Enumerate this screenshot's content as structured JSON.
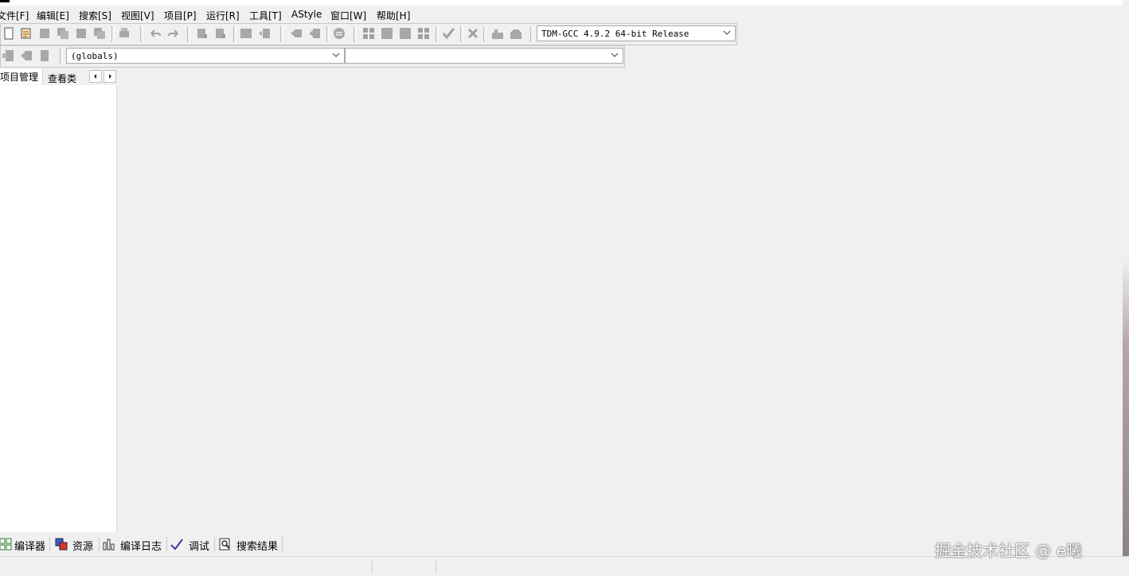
{
  "menubar": {
    "items": [
      "文件[F]",
      "编辑[E]",
      "搜索[S]",
      "视图[V]",
      "项目[P]",
      "运行[R]",
      "工具[T]",
      "AStyle",
      "窗口[W]",
      "帮助[H]"
    ]
  },
  "toolbar": {
    "compiler_select": "TDM-GCC 4.9.2 64-bit Release",
    "scope_select": "(globals)",
    "member_select": ""
  },
  "left_tabs": {
    "project": "项目管理",
    "classes": "查看类"
  },
  "bottom_tabs": {
    "compiler": "编译器",
    "resources": "资源",
    "compile_log": "编译日志",
    "debug": "调试",
    "search_results": "搜索结果"
  },
  "watermark": "掘金技术社区 @ e曦"
}
